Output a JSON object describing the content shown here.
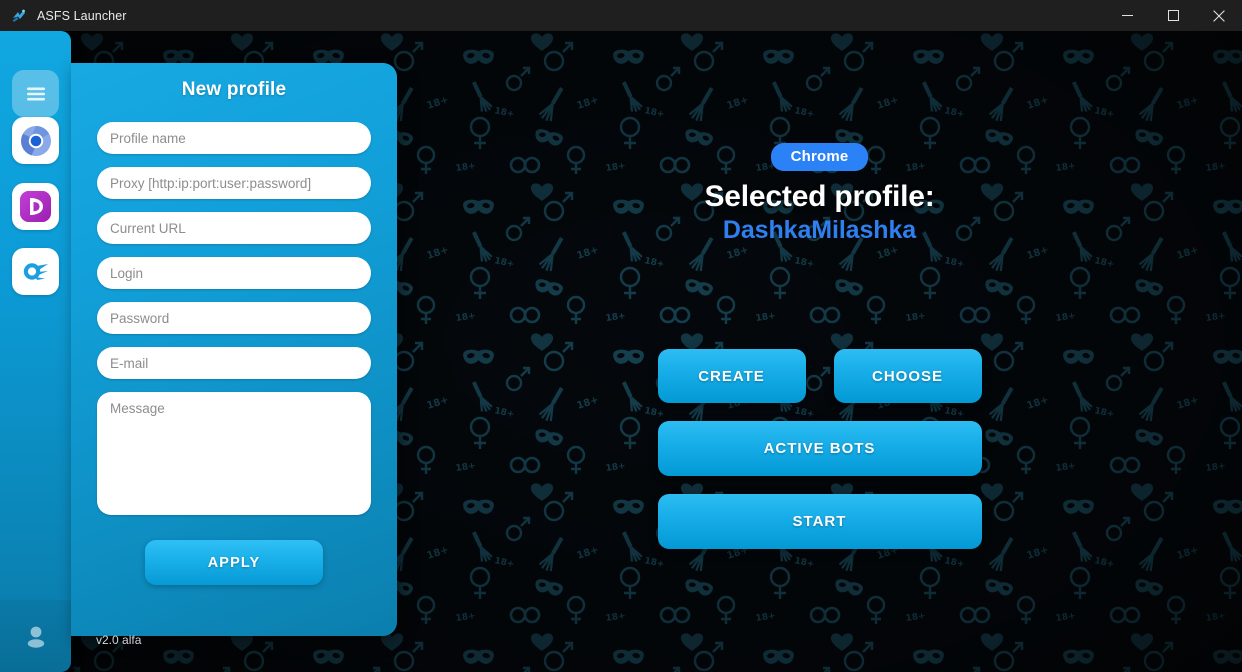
{
  "window": {
    "title": "ASFS Launcher",
    "icon": "app-logo-icon",
    "controls": {
      "minimize": "minimize-icon",
      "maximize": "maximize-icon",
      "close": "close-icon"
    }
  },
  "sidebar": {
    "items": [
      {
        "name": "menu",
        "icon": "hamburger-menu-icon",
        "label": "Menu"
      },
      {
        "name": "chrome",
        "icon": "chrome-browser-icon",
        "label": "Chrome"
      },
      {
        "name": "dolphin",
        "icon": "dolphin-anty-icon",
        "label": "Dolphin"
      },
      {
        "name": "comet",
        "icon": "comet-browser-icon",
        "label": "Comet"
      }
    ],
    "avatar": {
      "icon": "user-avatar-icon",
      "label": "Account"
    }
  },
  "form": {
    "title": "New profile",
    "fields": [
      {
        "name": "profile-name",
        "placeholder": "Profile name",
        "value": ""
      },
      {
        "name": "proxy",
        "placeholder": "Proxy [http:ip:port:user:password]",
        "value": ""
      },
      {
        "name": "current-url",
        "placeholder": "Current URL",
        "value": ""
      },
      {
        "name": "login",
        "placeholder": "Login",
        "value": ""
      },
      {
        "name": "password",
        "placeholder": "Password",
        "value": ""
      },
      {
        "name": "email",
        "placeholder": "E-mail",
        "value": ""
      }
    ],
    "message": {
      "placeholder": "Message",
      "value": ""
    },
    "apply_label": "APPLY"
  },
  "main": {
    "browser_badge": "Chrome",
    "selected_label": "Selected profile:",
    "selected_value": "DashkaMilashka",
    "buttons": {
      "create": "CREATE",
      "choose": "CHOOSE",
      "active_bots": "ACTIVE BOTS",
      "start": "START"
    }
  },
  "footer": {
    "version": "v2.0 alfa"
  },
  "colors": {
    "accent_blue": "#12a0da",
    "badge_blue": "#2b82f6",
    "profile_blue": "#2f7fef",
    "panel_blue": "#0e90c4",
    "titlebar": "#1f1f1f",
    "background": "#04080c"
  }
}
